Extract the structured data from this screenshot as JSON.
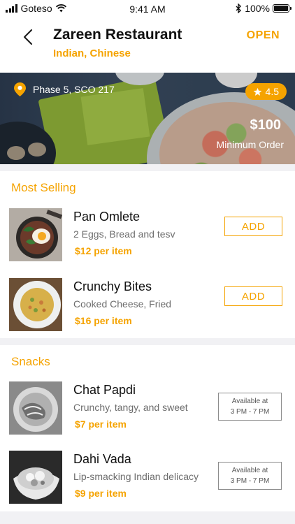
{
  "status_bar": {
    "carrier": "Goteso",
    "time": "9:41 AM",
    "battery": "100%"
  },
  "header": {
    "back_icon": "chevron-left-icon",
    "restaurant_name": "Zareen Restaurant",
    "cuisines": "Indian, Chinese",
    "status": "OPEN"
  },
  "banner": {
    "location": "Phase 5, SCO 217",
    "rating": "4.5",
    "minimum_price": "$100",
    "minimum_label": "Minimum Order"
  },
  "sections": [
    {
      "title": "Most Selling",
      "items": [
        {
          "name": "Pan Omlete",
          "description": "2 Eggs, Bread and tesv",
          "price": "$12 per item",
          "action": "ADD"
        },
        {
          "name": "Crunchy Bites",
          "description": "Cooked Cheese, Fried",
          "price": "$16 per item",
          "action": "ADD"
        }
      ]
    },
    {
      "title": "Snacks",
      "items": [
        {
          "name": "Chat Papdi",
          "description": "Crunchy, tangy, and sweet",
          "price": "$7 per item",
          "availability_line1": "Available at",
          "availability_line2": "3 PM - 7 PM"
        },
        {
          "name": "Dahi Vada",
          "description": "Lip-smacking Indian delicacy",
          "price": "$9 per item",
          "availability_line1": "Available at",
          "availability_line2": "3 PM - 7 PM"
        }
      ]
    }
  ],
  "colors": {
    "accent": "#f5a300",
    "text": "#111111",
    "muted": "#6d6d6d",
    "divider": "#f1f1f4"
  }
}
